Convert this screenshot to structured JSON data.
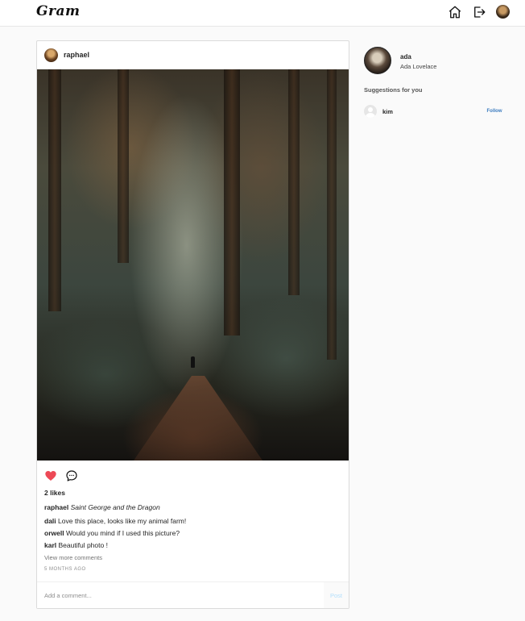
{
  "app": {
    "logo": "Gram"
  },
  "nav": {
    "icons": [
      "home-icon",
      "logout-icon",
      "profile-avatar"
    ]
  },
  "post": {
    "username": "raphael",
    "likes": "2 likes",
    "caption": {
      "username": "raphael",
      "text": "Saint George and the Dragon"
    },
    "comments": [
      {
        "username": "dali",
        "text": "Love this place, looks like my animal farm!"
      },
      {
        "username": "orwell",
        "text": "Would you mind if I used this picture?"
      },
      {
        "username": "karl",
        "text": "Beautiful photo !"
      }
    ],
    "view_more": "View more comments",
    "time": "5 MONTHS AGO",
    "comment_placeholder": "Add a comment...",
    "post_button": "Post",
    "liked": true,
    "colors": {
      "heart": "#ed4956",
      "post_button_disabled": "#b2dffc"
    }
  },
  "sidebar": {
    "username": "ada",
    "full_name": "Ada Lovelace",
    "suggestions_title": "Suggestions for you",
    "suggestions": [
      {
        "username": "kim",
        "action": "Follow"
      }
    ]
  }
}
